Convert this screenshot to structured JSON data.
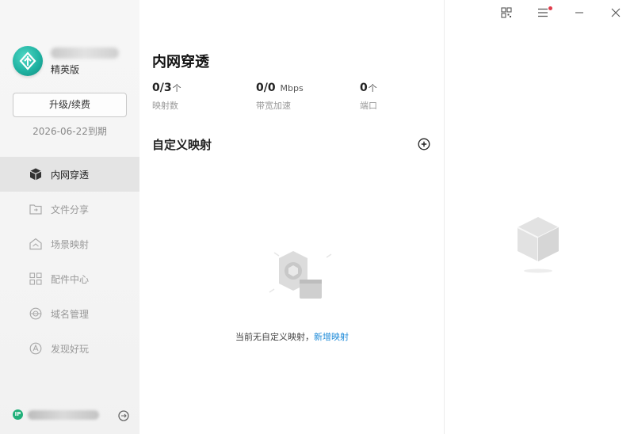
{
  "sidebar": {
    "edition": "精英版",
    "upgrade_label": "升级/续费",
    "expiry": "2026-06-22到期",
    "items": [
      {
        "label": "内网穿透",
        "icon": "cube-icon",
        "active": true
      },
      {
        "label": "文件分享",
        "icon": "folder-share-icon",
        "active": false
      },
      {
        "label": "场景映射",
        "icon": "home-map-icon",
        "active": false
      },
      {
        "label": "配件中心",
        "icon": "grid-icon",
        "active": false
      },
      {
        "label": "域名管理",
        "icon": "globe-icon",
        "active": false
      },
      {
        "label": "发现好玩",
        "icon": "compass-icon",
        "active": false
      }
    ],
    "footer": {
      "ip_badge": "IP"
    }
  },
  "main": {
    "title": "内网穿透",
    "stats": [
      {
        "value": "0/3",
        "unit": "个",
        "label": "映射数"
      },
      {
        "value": "0/0",
        "unit": "Mbps",
        "label": "带宽加速"
      },
      {
        "value": "0",
        "unit": "个",
        "label": "端口"
      }
    ],
    "section_title": "自定义映射",
    "empty_text": "当前无自定义映射，",
    "empty_link": "新增映射"
  },
  "colors": {
    "accent_link": "#1d8ad8",
    "brand": "#1fb3a2",
    "ip_badge": "#21b07a",
    "notification_dot": "#e03b4b"
  }
}
